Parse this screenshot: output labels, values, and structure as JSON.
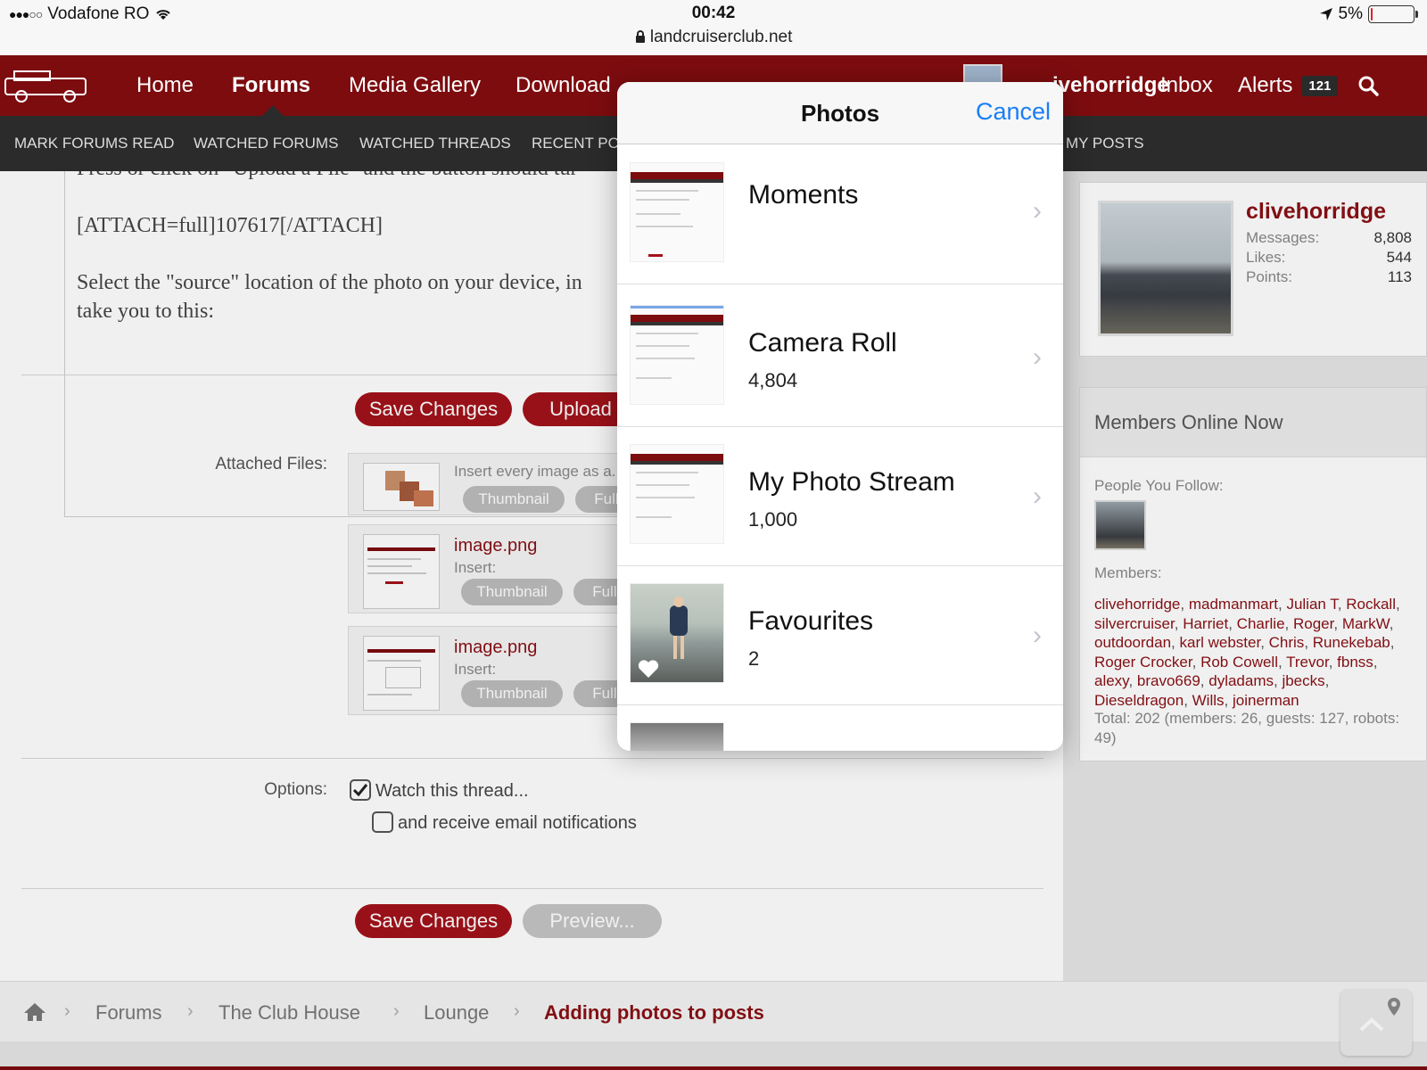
{
  "status_bar": {
    "carrier": "Vodafone RO",
    "time": "00:42",
    "url": "landcruiserclub.net",
    "battery": "5%",
    "battery_level": 0.05
  },
  "nav": {
    "items": [
      "Home",
      "Forums",
      "Media Gallery",
      "Download"
    ],
    "user": "clivehorridge",
    "user_visible": "ivehorridge",
    "inbox": "Inbox",
    "alerts": "Alerts",
    "alerts_count": "121"
  },
  "subnav": {
    "items": [
      "MARK FORUMS READ",
      "WATCHED FORUMS",
      "WATCHED THREADS",
      "RECENT PO",
      "MY POSTS"
    ]
  },
  "editor": {
    "line1": "Press or click on \"Upload a File\" and the button should tur",
    "line2": "[ATTACH=full]107617[/ATTACH]",
    "line3": "Select the \"source\" location of the photo on your device, in",
    "line4": "take you to this:"
  },
  "buttons": {
    "save_changes": "Save Changes",
    "upload": "Upload",
    "preview": "Preview..."
  },
  "attachments": {
    "label": "Attached Files:",
    "insert_every": "Insert every image as a...",
    "thumbnail": "Thumbnail",
    "full": "Full",
    "files": [
      {
        "name": "image.png",
        "insert": "Insert:"
      },
      {
        "name": "image.png",
        "insert": "Insert:"
      }
    ]
  },
  "options": {
    "label": "Options:",
    "watch": "Watch this thread...",
    "watch_checked": true,
    "email": "and receive email notifications",
    "email_checked": false
  },
  "profile": {
    "name": "clivehorridge",
    "stats": [
      {
        "label": "Messages:",
        "value": "8,808"
      },
      {
        "label": "Likes:",
        "value": "544"
      },
      {
        "label": "Points:",
        "value": "113"
      }
    ]
  },
  "members_online": {
    "title": "Members Online Now",
    "follow_label": "People You Follow:",
    "members_label": "Members:",
    "members": [
      "clivehorridge",
      "madmanmart",
      "Julian T",
      "Rockall",
      "silvercruiser",
      "Harriet",
      "Charlie",
      "Roger",
      "MarkW",
      "outdoordan",
      "karl webster",
      "Chris",
      "Runekebab",
      "Roger Crocker",
      "Rob Cowell",
      "Trevor",
      "fbnss",
      "alexy",
      "bravo669",
      "dyladams",
      "jbecks",
      "Dieseldragon",
      "Wills",
      "joinerman"
    ],
    "total": "Total: 202 (members: 26, guests: 127, robots: 49)"
  },
  "breadcrumb": {
    "items": [
      "Forums",
      "The Club House",
      "Lounge"
    ],
    "current": "Adding photos to posts"
  },
  "photos_popover": {
    "title": "Photos",
    "cancel": "Cancel",
    "albums": [
      {
        "name": "Moments",
        "count": ""
      },
      {
        "name": "Camera Roll",
        "count": "4,804"
      },
      {
        "name": "My Photo Stream",
        "count": "1,000"
      },
      {
        "name": "Favourites",
        "count": "2"
      }
    ]
  },
  "colors": {
    "brand": "#7d0c0f",
    "button_red": "#a3131a",
    "ios_blue": "#1a7ef5"
  }
}
